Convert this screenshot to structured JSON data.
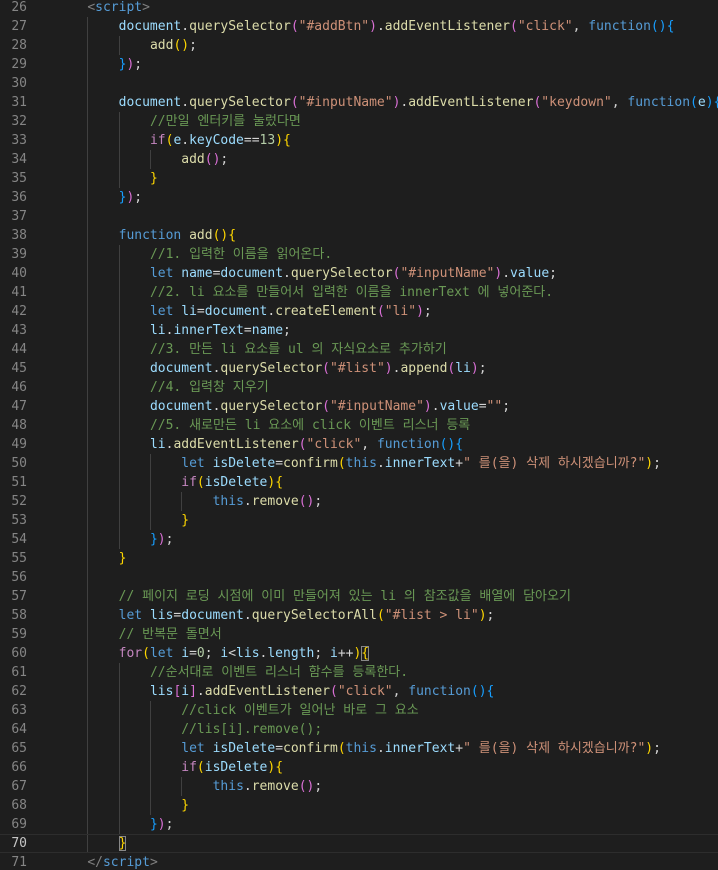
{
  "editor": {
    "colors": {
      "background": "#1e1e1e",
      "line_number": "#858585",
      "active_line_number": "#c6c6c6",
      "keyword": "#569cd6",
      "control": "#c586c0",
      "variable": "#9cdcfe",
      "function": "#dcdcaa",
      "string": "#ce9178",
      "comment": "#6a9955",
      "number": "#b5cea8",
      "tag": "#808080",
      "bracket_1": "#ffd700",
      "bracket_2": "#da70d6",
      "bracket_3": "#179fff"
    },
    "active_line": 70,
    "lines": [
      {
        "n": "26",
        "i": 1,
        "t": [
          [
            "<",
            "t"
          ],
          [
            "script",
            "k"
          ],
          [
            ">",
            "t"
          ]
        ]
      },
      {
        "n": "27",
        "i": 2,
        "t": [
          [
            "document",
            "v"
          ],
          [
            ".",
            "p"
          ],
          [
            "querySelector",
            "f"
          ],
          [
            "(",
            "b2"
          ],
          [
            "\"#addBtn\"",
            "s"
          ],
          [
            ")",
            "b2"
          ],
          [
            ".",
            "p"
          ],
          [
            "addEventListener",
            "f"
          ],
          [
            "(",
            "b2"
          ],
          [
            "\"click\"",
            "s"
          ],
          [
            ", ",
            "p"
          ],
          [
            "function",
            "k"
          ],
          [
            "()",
            "b3"
          ],
          [
            "{",
            "b3"
          ]
        ]
      },
      {
        "n": "28",
        "i": 3,
        "t": [
          [
            "add",
            "f"
          ],
          [
            "()",
            "b1"
          ],
          [
            ";",
            "p"
          ]
        ]
      },
      {
        "n": "29",
        "i": 2,
        "t": [
          [
            "}",
            "b3"
          ],
          [
            ")",
            "b2"
          ],
          [
            ";",
            "p"
          ]
        ]
      },
      {
        "n": "30",
        "i": 0,
        "t": []
      },
      {
        "n": "31",
        "i": 2,
        "t": [
          [
            "document",
            "v"
          ],
          [
            ".",
            "p"
          ],
          [
            "querySelector",
            "f"
          ],
          [
            "(",
            "b2"
          ],
          [
            "\"#inputName\"",
            "s"
          ],
          [
            ")",
            "b2"
          ],
          [
            ".",
            "p"
          ],
          [
            "addEventListener",
            "f"
          ],
          [
            "(",
            "b2"
          ],
          [
            "\"keydown\"",
            "s"
          ],
          [
            ", ",
            "p"
          ],
          [
            "function",
            "k"
          ],
          [
            "(",
            "b3"
          ],
          [
            "e",
            "v"
          ],
          [
            ")",
            "b3"
          ],
          [
            "{",
            "b3"
          ]
        ]
      },
      {
        "n": "32",
        "i": 3,
        "t": [
          [
            "//만일 엔터키를 눌렀다면",
            "c"
          ]
        ]
      },
      {
        "n": "33",
        "i": 3,
        "t": [
          [
            "if",
            "ctl"
          ],
          [
            "(",
            "b1"
          ],
          [
            "e",
            "v"
          ],
          [
            ".",
            "p"
          ],
          [
            "keyCode",
            "v"
          ],
          [
            "==",
            "p"
          ],
          [
            "13",
            "num"
          ],
          [
            ")",
            "b1"
          ],
          [
            "{",
            "b1"
          ]
        ]
      },
      {
        "n": "34",
        "i": 4,
        "t": [
          [
            "add",
            "f"
          ],
          [
            "()",
            "b2"
          ],
          [
            ";",
            "p"
          ]
        ]
      },
      {
        "n": "35",
        "i": 3,
        "t": [
          [
            "}",
            "b1"
          ]
        ]
      },
      {
        "n": "36",
        "i": 2,
        "t": [
          [
            "}",
            "b3"
          ],
          [
            ")",
            "b2"
          ],
          [
            ";",
            "p"
          ]
        ]
      },
      {
        "n": "37",
        "i": 0,
        "t": []
      },
      {
        "n": "38",
        "i": 2,
        "t": [
          [
            "function",
            "k"
          ],
          [
            " ",
            "p"
          ],
          [
            "add",
            "f"
          ],
          [
            "()",
            "b1"
          ],
          [
            "{",
            "b1"
          ]
        ]
      },
      {
        "n": "39",
        "i": 3,
        "t": [
          [
            "//1. 입력한 이름을 읽어온다.",
            "c"
          ]
        ]
      },
      {
        "n": "40",
        "i": 3,
        "t": [
          [
            "let",
            "k"
          ],
          [
            " ",
            "p"
          ],
          [
            "name",
            "v"
          ],
          [
            "=",
            "p"
          ],
          [
            "document",
            "v"
          ],
          [
            ".",
            "p"
          ],
          [
            "querySelector",
            "f"
          ],
          [
            "(",
            "b2"
          ],
          [
            "\"#inputName\"",
            "s"
          ],
          [
            ")",
            "b2"
          ],
          [
            ".",
            "p"
          ],
          [
            "value",
            "v"
          ],
          [
            ";",
            "p"
          ]
        ]
      },
      {
        "n": "41",
        "i": 3,
        "t": [
          [
            "//2. li 요소를 만들어서 입력한 이름을 innerText 에 넣어준다.",
            "c"
          ]
        ]
      },
      {
        "n": "42",
        "i": 3,
        "t": [
          [
            "let",
            "k"
          ],
          [
            " ",
            "p"
          ],
          [
            "li",
            "v"
          ],
          [
            "=",
            "p"
          ],
          [
            "document",
            "v"
          ],
          [
            ".",
            "p"
          ],
          [
            "createElement",
            "f"
          ],
          [
            "(",
            "b2"
          ],
          [
            "\"li\"",
            "s"
          ],
          [
            ")",
            "b2"
          ],
          [
            ";",
            "p"
          ]
        ]
      },
      {
        "n": "43",
        "i": 3,
        "t": [
          [
            "li",
            "v"
          ],
          [
            ".",
            "p"
          ],
          [
            "innerText",
            "v"
          ],
          [
            "=",
            "p"
          ],
          [
            "name",
            "v"
          ],
          [
            ";",
            "p"
          ]
        ]
      },
      {
        "n": "44",
        "i": 3,
        "t": [
          [
            "//3. 만든 li 요소를 ul 의 자식요소로 추가하기",
            "c"
          ]
        ]
      },
      {
        "n": "45",
        "i": 3,
        "t": [
          [
            "document",
            "v"
          ],
          [
            ".",
            "p"
          ],
          [
            "querySelector",
            "f"
          ],
          [
            "(",
            "b2"
          ],
          [
            "\"#list\"",
            "s"
          ],
          [
            ")",
            "b2"
          ],
          [
            ".",
            "p"
          ],
          [
            "append",
            "f"
          ],
          [
            "(",
            "b2"
          ],
          [
            "li",
            "v"
          ],
          [
            ")",
            "b2"
          ],
          [
            ";",
            "p"
          ]
        ]
      },
      {
        "n": "46",
        "i": 3,
        "t": [
          [
            "//4. 입력창 지우기",
            "c"
          ]
        ]
      },
      {
        "n": "47",
        "i": 3,
        "t": [
          [
            "document",
            "v"
          ],
          [
            ".",
            "p"
          ],
          [
            "querySelector",
            "f"
          ],
          [
            "(",
            "b2"
          ],
          [
            "\"#inputName\"",
            "s"
          ],
          [
            ")",
            "b2"
          ],
          [
            ".",
            "p"
          ],
          [
            "value",
            "v"
          ],
          [
            "=",
            "p"
          ],
          [
            "\"\"",
            "s"
          ],
          [
            ";",
            "p"
          ]
        ]
      },
      {
        "n": "48",
        "i": 3,
        "t": [
          [
            "//5. 새로만든 li 요소에 click 이벤트 리스너 등록",
            "c"
          ]
        ]
      },
      {
        "n": "49",
        "i": 3,
        "t": [
          [
            "li",
            "v"
          ],
          [
            ".",
            "p"
          ],
          [
            "addEventListener",
            "f"
          ],
          [
            "(",
            "b2"
          ],
          [
            "\"click\"",
            "s"
          ],
          [
            ", ",
            "p"
          ],
          [
            "function",
            "k"
          ],
          [
            "()",
            "b3"
          ],
          [
            "{",
            "b3"
          ]
        ]
      },
      {
        "n": "50",
        "i": 4,
        "t": [
          [
            "let",
            "k"
          ],
          [
            " ",
            "p"
          ],
          [
            "isDelete",
            "v"
          ],
          [
            "=",
            "p"
          ],
          [
            "confirm",
            "f"
          ],
          [
            "(",
            "b1"
          ],
          [
            "this",
            "k"
          ],
          [
            ".",
            "p"
          ],
          [
            "innerText",
            "v"
          ],
          [
            "+",
            "p"
          ],
          [
            "\" 를(을) 삭제 하시겠습니까?\"",
            "s"
          ],
          [
            ")",
            "b1"
          ],
          [
            ";",
            "p"
          ]
        ]
      },
      {
        "n": "51",
        "i": 4,
        "t": [
          [
            "if",
            "ctl"
          ],
          [
            "(",
            "b1"
          ],
          [
            "isDelete",
            "v"
          ],
          [
            ")",
            "b1"
          ],
          [
            "{",
            "b1"
          ]
        ]
      },
      {
        "n": "52",
        "i": 5,
        "t": [
          [
            "this",
            "k"
          ],
          [
            ".",
            "p"
          ],
          [
            "remove",
            "f"
          ],
          [
            "()",
            "b2"
          ],
          [
            ";",
            "p"
          ]
        ]
      },
      {
        "n": "53",
        "i": 4,
        "t": [
          [
            "}",
            "b1"
          ]
        ]
      },
      {
        "n": "54",
        "i": 3,
        "t": [
          [
            "}",
            "b3"
          ],
          [
            ")",
            "b2"
          ],
          [
            ";",
            "p"
          ]
        ]
      },
      {
        "n": "55",
        "i": 2,
        "t": [
          [
            "}",
            "b1"
          ]
        ]
      },
      {
        "n": "56",
        "i": 0,
        "t": []
      },
      {
        "n": "57",
        "i": 2,
        "t": [
          [
            "// 페이지 로딩 시점에 이미 만들어져 있는 li 의 참조값을 배열에 담아오기",
            "c"
          ]
        ]
      },
      {
        "n": "58",
        "i": 2,
        "t": [
          [
            "let",
            "k"
          ],
          [
            " ",
            "p"
          ],
          [
            "lis",
            "v"
          ],
          [
            "=",
            "p"
          ],
          [
            "document",
            "v"
          ],
          [
            ".",
            "p"
          ],
          [
            "querySelectorAll",
            "f"
          ],
          [
            "(",
            "b1"
          ],
          [
            "\"#list > li\"",
            "s"
          ],
          [
            ")",
            "b1"
          ],
          [
            ";",
            "p"
          ]
        ]
      },
      {
        "n": "59",
        "i": 2,
        "t": [
          [
            "// 반복문 돌면서",
            "c"
          ]
        ]
      },
      {
        "n": "60",
        "i": 2,
        "t": [
          [
            "for",
            "ctl"
          ],
          [
            "(",
            "b1"
          ],
          [
            "let",
            "k"
          ],
          [
            " ",
            "p"
          ],
          [
            "i",
            "v"
          ],
          [
            "=",
            "p"
          ],
          [
            "0",
            "num"
          ],
          [
            "; ",
            "p"
          ],
          [
            "i",
            "v"
          ],
          [
            "<",
            "p"
          ],
          [
            "lis",
            "v"
          ],
          [
            ".",
            "p"
          ],
          [
            "length",
            "v"
          ],
          [
            "; ",
            "p"
          ],
          [
            "i",
            "v"
          ],
          [
            "++",
            "p"
          ],
          [
            ")",
            "b1"
          ],
          [
            "{",
            "b1m"
          ]
        ]
      },
      {
        "n": "61",
        "i": 3,
        "t": [
          [
            "//순서대로 이벤트 리스너 함수를 등록한다.",
            "c"
          ]
        ]
      },
      {
        "n": "62",
        "i": 3,
        "t": [
          [
            "lis",
            "v"
          ],
          [
            "[",
            "b2"
          ],
          [
            "i",
            "v"
          ],
          [
            "]",
            "b2"
          ],
          [
            ".",
            "p"
          ],
          [
            "addEventListener",
            "f"
          ],
          [
            "(",
            "b2"
          ],
          [
            "\"click\"",
            "s"
          ],
          [
            ", ",
            "p"
          ],
          [
            "function",
            "k"
          ],
          [
            "()",
            "b3"
          ],
          [
            "{",
            "b3"
          ]
        ]
      },
      {
        "n": "63",
        "i": 4,
        "t": [
          [
            "//click 이벤트가 일어난 바로 그 요소",
            "c"
          ]
        ]
      },
      {
        "n": "64",
        "i": 4,
        "t": [
          [
            "//lis[i].remove();",
            "c"
          ]
        ]
      },
      {
        "n": "65",
        "i": 4,
        "t": [
          [
            "let",
            "k"
          ],
          [
            " ",
            "p"
          ],
          [
            "isDelete",
            "v"
          ],
          [
            "=",
            "p"
          ],
          [
            "confirm",
            "f"
          ],
          [
            "(",
            "b1"
          ],
          [
            "this",
            "k"
          ],
          [
            ".",
            "p"
          ],
          [
            "innerText",
            "v"
          ],
          [
            "+",
            "p"
          ],
          [
            "\" 를(을) 삭제 하시겠습니까?\"",
            "s"
          ],
          [
            ")",
            "b1"
          ],
          [
            ";",
            "p"
          ]
        ]
      },
      {
        "n": "66",
        "i": 4,
        "t": [
          [
            "if",
            "ctl"
          ],
          [
            "(",
            "b1"
          ],
          [
            "isDelete",
            "v"
          ],
          [
            ")",
            "b1"
          ],
          [
            "{",
            "b1"
          ]
        ]
      },
      {
        "n": "67",
        "i": 5,
        "t": [
          [
            "this",
            "k"
          ],
          [
            ".",
            "p"
          ],
          [
            "remove",
            "f"
          ],
          [
            "()",
            "b2"
          ],
          [
            ";",
            "p"
          ]
        ]
      },
      {
        "n": "68",
        "i": 4,
        "t": [
          [
            "}",
            "b1"
          ]
        ]
      },
      {
        "n": "69",
        "i": 3,
        "t": [
          [
            "}",
            "b3"
          ],
          [
            ")",
            "b2"
          ],
          [
            ";",
            "p"
          ]
        ]
      },
      {
        "n": "70",
        "i": 2,
        "t": [
          [
            "}",
            "b1m"
          ]
        ]
      },
      {
        "n": "71",
        "i": 1,
        "t": [
          [
            "</",
            "t"
          ],
          [
            "script",
            "k"
          ],
          [
            ">",
            "t"
          ]
        ]
      }
    ]
  }
}
